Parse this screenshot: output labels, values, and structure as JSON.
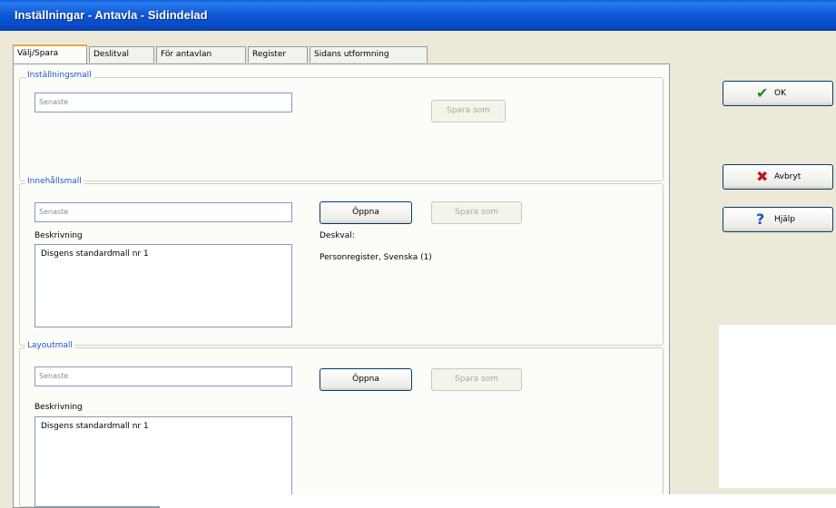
{
  "window": {
    "title": "Inställningar - Antavla - Sidindelad"
  },
  "tabs": [
    "Välj/Spara",
    "Deslitval",
    "För antavlan",
    "Register",
    "Sidans utformning"
  ],
  "groups": {
    "installningsmall": {
      "legend": "Inställningsmall",
      "field_placeholder": "Senaste",
      "save_as_label": "Spara som"
    },
    "innehallsmall": {
      "legend": "Innehållsmall",
      "field_placeholder": "Senaste",
      "open_label": "Öppna",
      "save_as_label": "Spara som",
      "description_label": "Beskrivning",
      "description_text": "Disgens standardmall nr 1",
      "selection_label": "Deskval:",
      "selection_value": "Personregister, Svenska (1)"
    },
    "layoutmall": {
      "legend": "Layoutmall",
      "field_placeholder": "Senaste",
      "open_label": "Öppna",
      "save_as_label": "Spara som",
      "description_label": "Beskrivning",
      "description_text": "Disgens standardmall nr 1"
    }
  },
  "side_buttons": {
    "ok": "OK",
    "cancel": "Avbryt",
    "help": "Hjälp"
  },
  "colors": {
    "ok_check": "#1e8a1e",
    "cancel_x": "#c0171b",
    "help_q": "#1c4fc4"
  }
}
